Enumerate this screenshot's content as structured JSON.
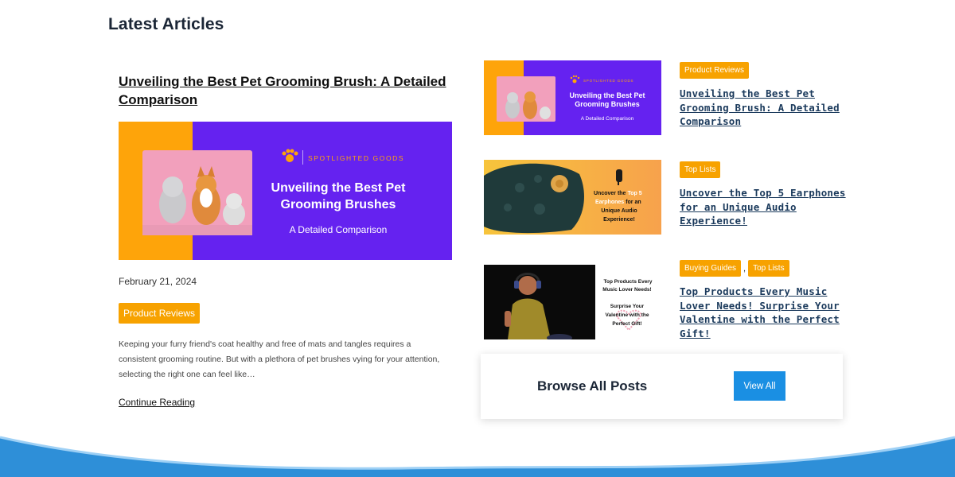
{
  "section": {
    "title": "Latest Articles"
  },
  "featured": {
    "title": "Unveiling the Best Pet Grooming Brush: A Detailed Comparison",
    "image": {
      "brand": "SPOTLIGHTED GOODS",
      "headline_line1": "Unveiling the Best Pet",
      "headline_line2": "Grooming Brushes",
      "subline": "A Detailed Comparison"
    },
    "date": "February 21, 2024",
    "tag": "Product Reviews",
    "excerpt": "Keeping your furry friend's coat healthy and free of mats and tangles requires a consistent grooming routine. But with a plethora of pet brushes vying for your attention, selecting the right one can feel like…",
    "continue_label": "Continue Reading"
  },
  "side_articles": [
    {
      "tags": [
        "Product Reviews"
      ],
      "title": "Unveiling the Best Pet Grooming Brush: A Detailed Comparison",
      "thumb": {
        "brand": "SPOTLIGHTED GOODS",
        "line1": "Unveiling the Best Pet",
        "line2": "Grooming Brushes",
        "line3": "A Detailed Comparison"
      }
    },
    {
      "tags": [
        "Top Lists"
      ],
      "title": "Uncover the Top 5 Earphones for an Unique Audio Experience!",
      "thumb": {
        "line1a": "Uncover the",
        "line1b": "Top 5",
        "line2a": "Earphones",
        "line2b": "for an",
        "line3": "Unique Audio",
        "line4": "Experience!"
      }
    },
    {
      "tags": [
        "Buying Guides",
        "Top Lists"
      ],
      "title": "Top Products Every Music Lover Needs! Surprise Your Valentine with the Perfect Gift!",
      "thumb": {
        "line1": "Top Products Every",
        "line2": "Music Lover Needs!",
        "line3": "Surprise Your",
        "line4": "Valentine with the",
        "line5": "Perfect Gift!"
      }
    }
  ],
  "browse": {
    "label": "Browse All Posts",
    "button": "View All"
  },
  "colors": {
    "accent_tag": "#f7a200",
    "button_blue": "#1a8fe3",
    "purple": "#6522f0",
    "orange": "#fea40a"
  }
}
